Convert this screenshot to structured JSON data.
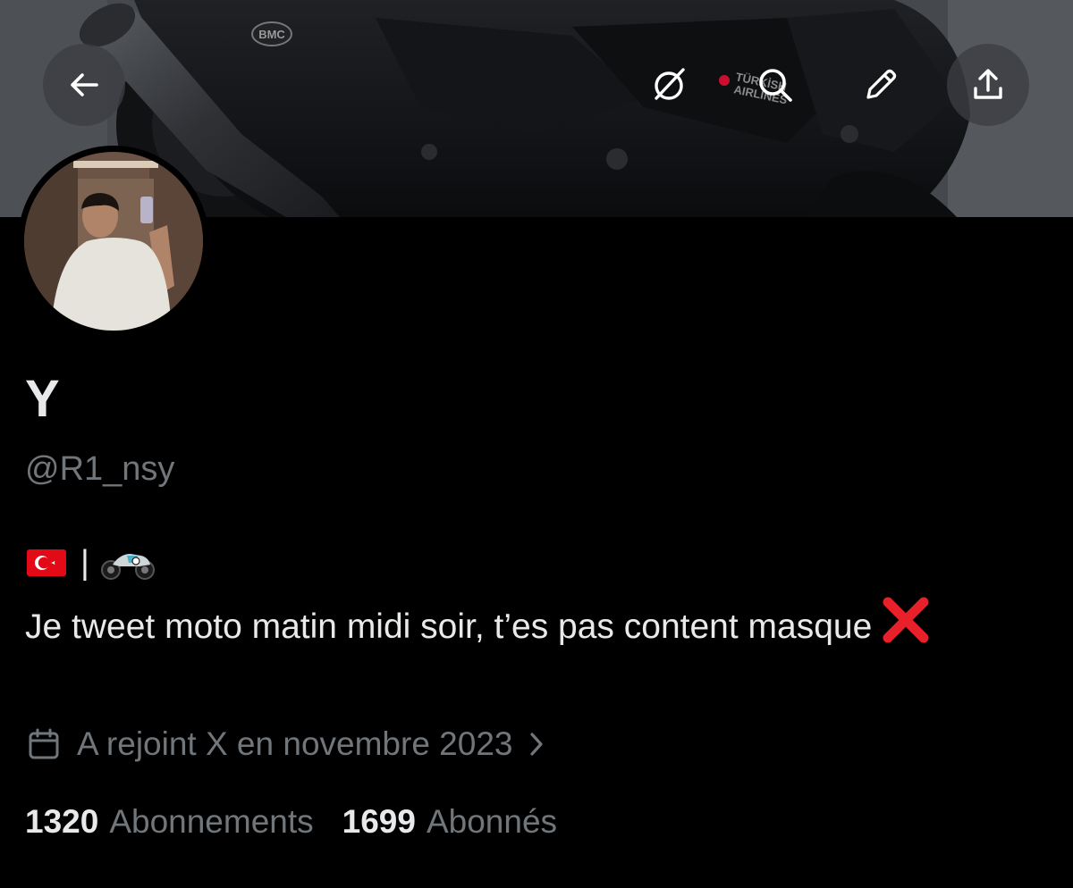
{
  "profile": {
    "display_name": "Y",
    "handle": "@R1_nsy",
    "bio_flag": "🇹🇷",
    "bio_separator": "|",
    "bio_text": "Je tweet moto matin midi soir, t’es pas content masque",
    "joined_text": "A rejoint X en novembre 2023",
    "following_count": "1320",
    "following_label": "Abonnements",
    "followers_count": "1699",
    "followers_label": "Abonnés"
  },
  "banner": {
    "airline_logo_text": [
      "TÜRKİSH",
      "AIRLINES"
    ],
    "exhaust_brand": "BMC"
  },
  "icons": {
    "back": "arrow-left-icon",
    "grok": "grok-icon",
    "search": "search-icon",
    "edit": "pencil-icon",
    "share": "share-upload-icon",
    "calendar": "calendar-icon",
    "chevron": "chevron-right-icon",
    "bio_emoji_motorcycle": "motorcycle-emoji",
    "bio_emoji_cross": "cross-mark-emoji"
  },
  "colors": {
    "background": "#000000",
    "primary_text": "#e7e9ea",
    "secondary_text": "#71767b",
    "cross_mark": "#e8202a",
    "flag_red": "#e30a17"
  }
}
